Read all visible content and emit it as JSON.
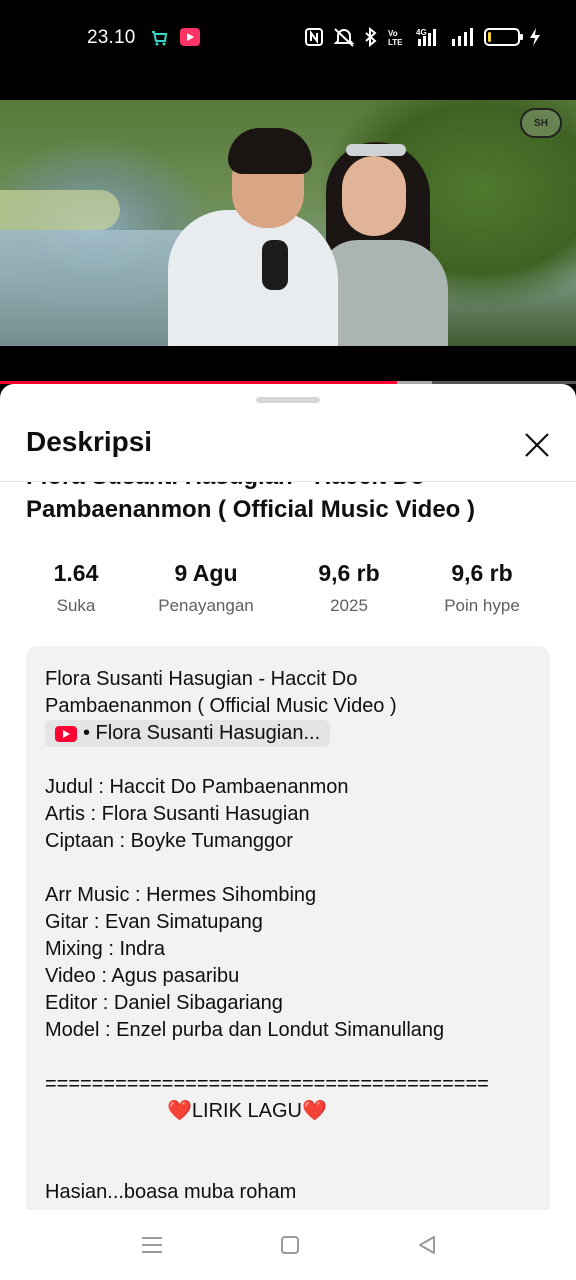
{
  "status_bar": {
    "time": "23.10",
    "network_label": "4G",
    "volte_label": "Vo LTE",
    "battery_level_pct": 12,
    "icons": [
      "shopping-bag-icon",
      "youtube-notification-icon",
      "nfc-icon",
      "mute-icon",
      "bluetooth-icon",
      "volte-icon",
      "signal-icon",
      "battery-icon",
      "charging-icon"
    ]
  },
  "video": {
    "channel_logo_text": "SH",
    "progress_pct": 69,
    "buffer_pct": 75,
    "colors": {
      "progress": "#ff0033"
    }
  },
  "sheet": {
    "title": "Deskripsi",
    "video_title_line1": "Flora Susanti Hasugian - Haccit Do",
    "video_title_line2": "Pambaenanmon ( Official Music Video )",
    "stats": [
      {
        "value": "1.64",
        "label": "Suka"
      },
      {
        "value": "9 Agu",
        "label": "Penayangan"
      },
      {
        "value": "9,6 rb",
        "label": "2025"
      },
      {
        "value": "9,6 rb",
        "label": "Poin hype"
      }
    ],
    "description": {
      "line1": "Flora Susanti Hasugian - Haccit Do",
      "line2": "Pambaenanmon ( Official Music Video )",
      "channel_chip": "• Flora Susanti Hasugian...",
      "credits_1": [
        "Judul : Haccit Do Pambaenanmon",
        "Artis :  Flora Susanti Hasugian",
        "Ciptaan : Boyke Tumanggor"
      ],
      "credits_2": [
        "Arr Music : Hermes Sihombing",
        "Gitar : Evan Simatupang",
        "Mixing : Indra",
        "Video : Agus pasaribu",
        "Editor : Daniel Sibagariang",
        "Model : Enzel purba dan Londut Simanullang"
      ],
      "separator": "======================================",
      "lirik_heading": "LIRIK LAGU",
      "heart": "❤️",
      "lyric_first_line": "Hasian...boasa muba roham"
    }
  },
  "nav_bar": {
    "buttons": [
      "menu-icon",
      "home-icon",
      "back-icon"
    ]
  }
}
